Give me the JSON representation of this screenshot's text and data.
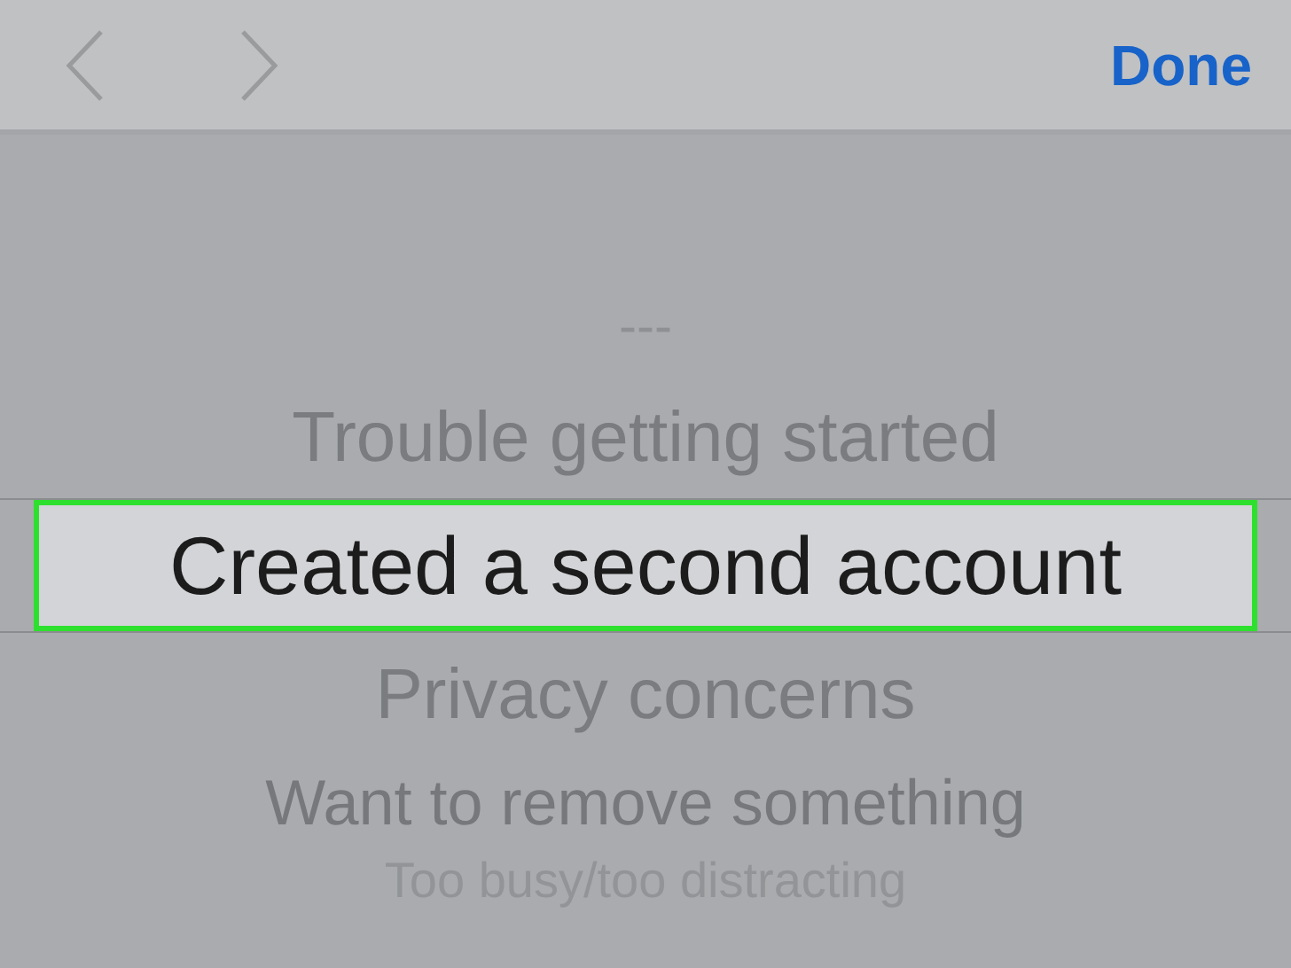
{
  "toolbar": {
    "back_disabled": true,
    "forward_disabled": true,
    "done": "Done"
  },
  "picker": {
    "items": [
      {
        "label": "---",
        "selected": false
      },
      {
        "label": "Trouble getting started",
        "selected": false
      },
      {
        "label": "Created a second account",
        "selected": true
      },
      {
        "label": "Privacy concerns",
        "selected": false
      },
      {
        "label": "Want to remove something",
        "selected": false
      },
      {
        "label": "Too busy/too distracting",
        "selected": false
      }
    ]
  }
}
